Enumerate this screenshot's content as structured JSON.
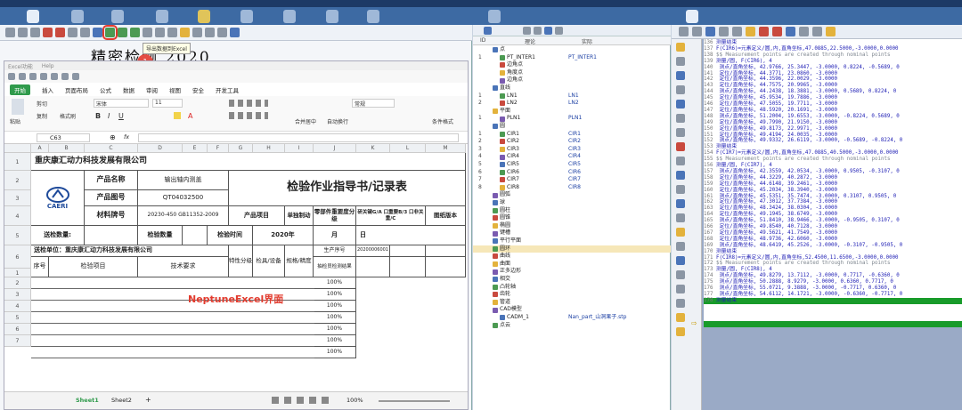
{
  "left_panel": {
    "tooltip": "导出数据到Excel",
    "doc_title": "精密检测 2020",
    "badge1": "1",
    "badge2": "2"
  },
  "excel": {
    "menu": [
      "Excel功能",
      "Help"
    ],
    "tabs": [
      "开始",
      "插入",
      "页面布局",
      "公式",
      "数据",
      "审阅",
      "视图",
      "安全",
      "开发工具"
    ],
    "ribbon": {
      "cut": "剪切",
      "copy": "复制",
      "format_painter": "格式刷",
      "paste": "粘贴",
      "font_name": "宋体",
      "font_size": "11",
      "merge": "合并居中",
      "wrap": "自动换行",
      "number_format": "常规",
      "cond_format": "条件格式"
    },
    "namebox": "C63",
    "fx": "fx",
    "columns": [
      "A",
      "B",
      "C",
      "D",
      "E",
      "F",
      "G",
      "H",
      "I",
      "J",
      "K",
      "L",
      "M"
    ],
    "rows": [
      "1",
      "2",
      "3",
      "4",
      "5",
      "6",
      "1",
      "2",
      "3",
      "4",
      "5",
      "6",
      "7"
    ],
    "company": "重庆康汇动力科技发展有限公司",
    "logo_text": "CAERI",
    "product_name_label": "产品名称",
    "product_name_value": "输出轴内测盖",
    "product_no_label": "产品图号",
    "product_no_value": "QT04032500",
    "material_label": "材料牌号",
    "material_value": "20230-450 GB11352-2009",
    "doc_heading": "检验作业指导书/记录表",
    "item_label": "产品项目",
    "unit_label": "单独制动",
    "importance_label": "零部件重要度分级",
    "grade_text": "研关键G/A 口重要B/3 口非关重/C",
    "drawing_label": "图纸版本",
    "qty_label": "送检数量:",
    "inspect_qty_label": "检验数量",
    "inspect_time_label": "检验时间",
    "year_text": "2020年",
    "month_text": "月",
    "day_text": "日",
    "unit_full": "送检单位：重庆康汇动力科技发展有限公司",
    "attr_label": "特性分级",
    "tool_label": "检具/设备",
    "precision_label": "规格/精度",
    "prod_seq_label": "生产序号",
    "prod_seq_value": "20200006001",
    "check_result_label": "抽检员检测结果",
    "seq_label": "序号",
    "check_item_label": "检验项目",
    "tech_req_label": "技术要求",
    "watermark": "NeptuneExcel界面",
    "percent": [
      "100%",
      "100%",
      "100%",
      "100%",
      "100%",
      "100%",
      "100%"
    ],
    "sheet_tabs": [
      "Sheet1",
      "Sheet2"
    ],
    "add_sheet": "+",
    "zoom": "100%"
  },
  "middle_panel": {
    "columns": [
      "ID",
      "理论",
      "实际"
    ],
    "tree": [
      {
        "n": "",
        "indent": 0,
        "label": "点",
        "ref": ""
      },
      {
        "n": "1",
        "indent": 1,
        "label": "PT_INTER1",
        "ref": "PT_INTER1"
      },
      {
        "n": "",
        "indent": 1,
        "label": "边角点",
        "ref": ""
      },
      {
        "n": "",
        "indent": 1,
        "label": "角度点",
        "ref": ""
      },
      {
        "n": "",
        "indent": 1,
        "label": "边角点",
        "ref": ""
      },
      {
        "n": "",
        "indent": 0,
        "label": "直线",
        "ref": ""
      },
      {
        "n": "1",
        "indent": 1,
        "label": "LN1",
        "ref": "LN1"
      },
      {
        "n": "2",
        "indent": 1,
        "label": "LN2",
        "ref": "LN2"
      },
      {
        "n": "",
        "indent": 0,
        "label": "平面",
        "ref": ""
      },
      {
        "n": "1",
        "indent": 1,
        "label": "PLN1",
        "ref": "PLN1"
      },
      {
        "n": "",
        "indent": 0,
        "label": "圆",
        "ref": ""
      },
      {
        "n": "1",
        "indent": 1,
        "label": "CIR1",
        "ref": "CIR1"
      },
      {
        "n": "2",
        "indent": 1,
        "label": "CIR2",
        "ref": "CIR2"
      },
      {
        "n": "3",
        "indent": 1,
        "label": "CIR3",
        "ref": "CIR3"
      },
      {
        "n": "4",
        "indent": 1,
        "label": "CIR4",
        "ref": "CIR4"
      },
      {
        "n": "5",
        "indent": 1,
        "label": "CIR5",
        "ref": "CIR5"
      },
      {
        "n": "6",
        "indent": 1,
        "label": "CIR6",
        "ref": "CIR6"
      },
      {
        "n": "7",
        "indent": 1,
        "label": "CIR7",
        "ref": "CIR7"
      },
      {
        "n": "8",
        "indent": 1,
        "label": "CIR8",
        "ref": "CIR8"
      },
      {
        "n": "",
        "indent": 0,
        "label": "圆弧",
        "ref": ""
      },
      {
        "n": "",
        "indent": 0,
        "label": "球",
        "ref": ""
      },
      {
        "n": "",
        "indent": 0,
        "label": "圆柱",
        "ref": ""
      },
      {
        "n": "",
        "indent": 0,
        "label": "圆锥",
        "ref": ""
      },
      {
        "n": "",
        "indent": 0,
        "label": "椭圆",
        "ref": ""
      },
      {
        "n": "",
        "indent": 0,
        "label": "键槽",
        "ref": ""
      },
      {
        "n": "",
        "indent": 0,
        "label": "平行平面",
        "ref": ""
      },
      {
        "n": "",
        "indent": 0,
        "label": "圆环",
        "ref": ""
      },
      {
        "n": "",
        "indent": 0,
        "label": "曲线",
        "ref": ""
      },
      {
        "n": "",
        "indent": 0,
        "label": "曲面",
        "ref": ""
      },
      {
        "n": "",
        "indent": 0,
        "label": "正多边形",
        "ref": ""
      },
      {
        "n": "",
        "indent": 0,
        "label": "相交",
        "ref": ""
      },
      {
        "n": "",
        "indent": 0,
        "label": "凸轮轴",
        "ref": ""
      },
      {
        "n": "",
        "indent": 0,
        "label": "齿轮",
        "ref": ""
      },
      {
        "n": "",
        "indent": 0,
        "label": "管道",
        "ref": ""
      },
      {
        "n": "",
        "indent": 0,
        "label": "CAD模型",
        "ref": ""
      },
      {
        "n": "",
        "indent": 1,
        "label": "CADM_1",
        "ref": "Nan_part_山洞果子.stp"
      },
      {
        "n": "",
        "indent": 0,
        "label": "点云",
        "ref": ""
      }
    ]
  },
  "right_panel": {
    "lines": [
      {
        "no": "136",
        "t": "测量结束"
      },
      {
        "no": "137",
        "t": "F(CIR6)=元素定义/圆,内,直角坐标,47.0885,22.5000,-3.0000,0.0000"
      },
      {
        "no": "138",
        "t": "$$ Measurement points are created through nominal points",
        "gray": true
      },
      {
        "no": "139",
        "t": "测量/圆, F(CIR6), 4"
      },
      {
        "no": "140",
        "t": "    测点/直角坐标, 42.9766, 25.3447, -3.0000, 0.8224, -0.5689, 0"
      },
      {
        "no": "141",
        "t": "    定位/直角坐标,  44.3771, 23.0860, -3.0000"
      },
      {
        "no": "142",
        "t": "    定位/直角坐标,  44.3596, 22.0029, -3.0000"
      },
      {
        "no": "143",
        "t": "    定位/直角坐标,  44.7575, 20.9965, -3.0000"
      },
      {
        "no": "144",
        "t": "    测点/直角坐标, 44.2438, 18.3881, -3.0000, 0.5689, 0.8224, 0"
      },
      {
        "no": "145",
        "t": "    定位/直角坐标,  45.9534, 19.7886, -3.0000"
      },
      {
        "no": "146",
        "t": "    定位/直角坐标,  47.5055, 19.7711, -3.0000"
      },
      {
        "no": "147",
        "t": "    定位/直角坐标,  48.5920, 20.1691, -3.0000"
      },
      {
        "no": "148",
        "t": "    测点/直角坐标, 51.2004, 19.6553, -3.0000, -0.8224, 0.5689, 0"
      },
      {
        "no": "149",
        "t": "    定位/直角坐标,  49.7990, 21.9150, -3.0000"
      },
      {
        "no": "150",
        "t": "    定位/直角坐标,  49.8173, 22.9971, -3.0000"
      },
      {
        "no": "151",
        "t": "    定位/直角坐标,  49.4194, 24.0035, -3.0000"
      },
      {
        "no": "152",
        "t": "    测点/直角坐标, 49.9332, 26.6119, -3.0000, -0.5689, -0.8224, 0"
      },
      {
        "no": "153",
        "t": "测量结束"
      },
      {
        "no": "154",
        "t": "F(CIR7)=元素定义/圆,内,直角坐标,47.0885,40.5000,-3.0000,0.0000"
      },
      {
        "no": "155",
        "t": "$$ Measurement points are created through nominal points",
        "gray": true
      },
      {
        "no": "156",
        "t": "测量/圆, F(CIR7), 4"
      },
      {
        "no": "157",
        "t": "    测点/直角坐标, 42.3559, 42.0534, -3.0000, 0.9505, -0.3107, 0"
      },
      {
        "no": "158",
        "t": "    定位/直角坐标,  44.3229, 40.2872, -3.0000"
      },
      {
        "no": "159",
        "t": "    定位/直角坐标,  44.6148, 39.2461, -3.0000"
      },
      {
        "no": "160",
        "t": "    定位/直角坐标,  45.2034, 38.3940, -3.0000"
      },
      {
        "no": "161",
        "t": "    测点/直角坐标, 45.5351, 35.7474, -3.0000, 0.3107, 0.9505, 0"
      },
      {
        "no": "162",
        "t": "    定位/直角坐标,  47.3012, 37.7384, -3.0000"
      },
      {
        "no": "163",
        "t": "    定位/直角坐标,  48.3424, 38.0304, -3.0000"
      },
      {
        "no": "164",
        "t": "    定位/直角坐标,  49.1945, 38.6749, -3.0000"
      },
      {
        "no": "165",
        "t": "    测点/直角坐标, 51.8410, 38.9466, -3.0000, -0.9505, 0.3107, 0"
      },
      {
        "no": "166",
        "t": "    定位/直角坐标,  49.8540, 40.7128, -3.0000"
      },
      {
        "no": "167",
        "t": "    定位/直角坐标,  49.5621, 41.7549, -3.0000"
      },
      {
        "no": "168",
        "t": "    定位/直角坐标,  48.9736, 42.6060, -3.0000"
      },
      {
        "no": "169",
        "t": "    测点/直角坐标, 48.6419, 45.2526, -3.0000, -0.3107, -0.9505, 0"
      },
      {
        "no": "170",
        "t": "测量结束"
      },
      {
        "no": "171",
        "t": "F(CIR8)=元素定义/圆,内,直角坐标,52.4500,11.6500,-3.0000,0.0000"
      },
      {
        "no": "172",
        "t": "$$ Measurement points are created through nominal points",
        "gray": true
      },
      {
        "no": "173",
        "t": "测量/圆, F(CIR8), 4"
      },
      {
        "no": "174",
        "t": "    测点/直角坐标, 49.8279, 13.7112, -3.0000, 0.7717, -0.6360, 0"
      },
      {
        "no": "175",
        "t": "    测点/直角坐标, 50.2888, 8.9279, -3.0000, 0.6360, 0.7717, 0"
      },
      {
        "no": "176",
        "t": "    测点/直角坐标, 55.0721, 9.3888, -3.0000, -0.7717, 0.6360, 0"
      },
      {
        "no": "177",
        "t": "    测点/直角坐标, 54.6112, 14.1721, -3.0000, -0.6360, -0.7717, 0"
      },
      {
        "no": "178",
        "t": "测量结束"
      }
    ]
  }
}
